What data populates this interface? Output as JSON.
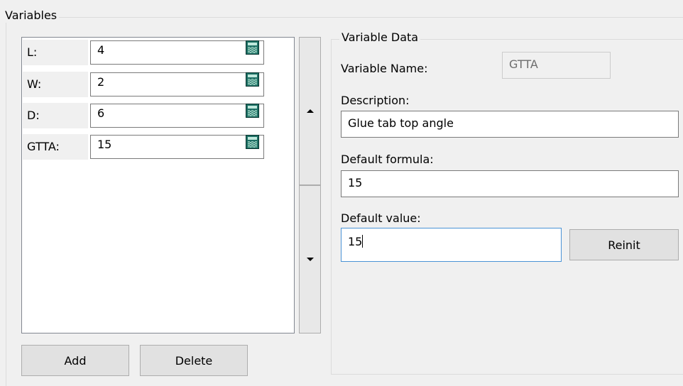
{
  "variables_group": {
    "title": "Variables"
  },
  "variables": [
    {
      "label": "L:",
      "value": "4"
    },
    {
      "label": "W:",
      "value": "2"
    },
    {
      "label": "D:",
      "value": "6"
    },
    {
      "label": "GTTA:",
      "value": "15"
    }
  ],
  "list_buttons": {
    "add": "Add",
    "delete": "Delete"
  },
  "variable_data": {
    "title": "Variable Data",
    "name_label": "Variable Name:",
    "name_value": "GTTA",
    "description_label": "Description:",
    "description_value": "Glue tab top angle",
    "formula_label": "Default formula:",
    "formula_value": "15",
    "value_label": "Default value:",
    "value_value": "15",
    "reinit_label": "Reinit"
  },
  "icons": {
    "calculator": "calculator-icon",
    "scroll_up": "arrow-up-icon",
    "scroll_down": "arrow-down-icon"
  },
  "colors": {
    "focus_border": "#4a93d6",
    "calculator": "#1d6f64"
  }
}
